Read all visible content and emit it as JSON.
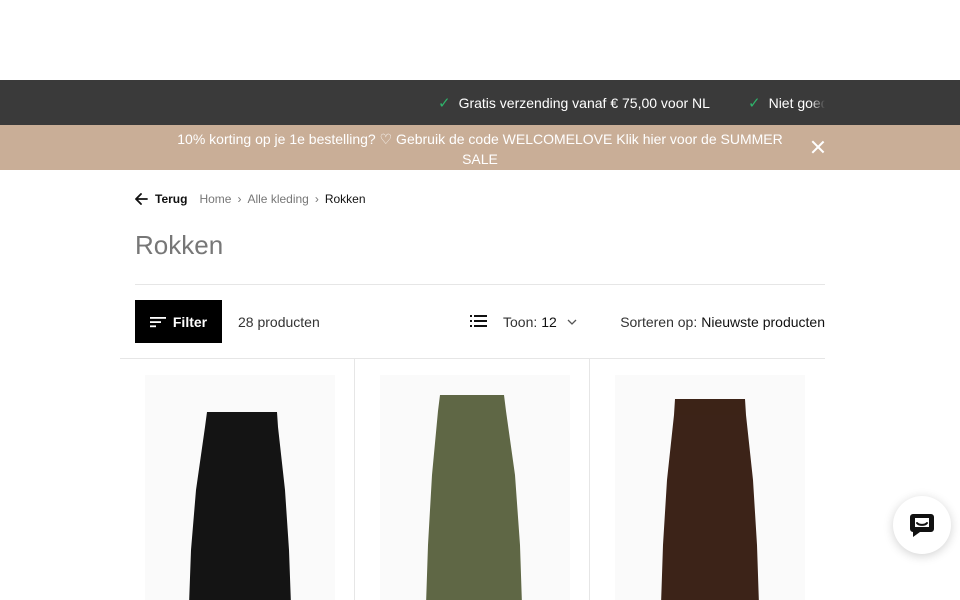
{
  "usp": {
    "items": [
      {
        "label": "Gratis verzending vanaf € 75,00 voor NL",
        "icon": "check-icon"
      },
      {
        "label": "Niet goed",
        "icon": "check-icon"
      }
    ],
    "check_color": "#2fb26a"
  },
  "promo": {
    "text": "10% korting op je 1e bestelling? ♡ Gebruik de code WELCOMELOVE  Klik hier voor de SUMMER SALE",
    "background": "#c9ae97"
  },
  "breadcrumb": {
    "back_label": "Terug",
    "items": [
      "Home",
      "Alle kleding"
    ],
    "current": "Rokken"
  },
  "page": {
    "title": "Rokken"
  },
  "toolbar": {
    "filter_label": "Filter",
    "count": "28 producten",
    "show_label": "Toon:",
    "show_value": "12",
    "sort_label": "Sorteren op:",
    "sort_value": "Nieuwste producten"
  },
  "products": [
    {
      "color_name": "black",
      "color": "#141414"
    },
    {
      "color_name": "olive",
      "color": "#5f6745"
    },
    {
      "color_name": "brown",
      "color": "#3c2318"
    }
  ],
  "chat": {
    "icon": "chat-icon"
  }
}
